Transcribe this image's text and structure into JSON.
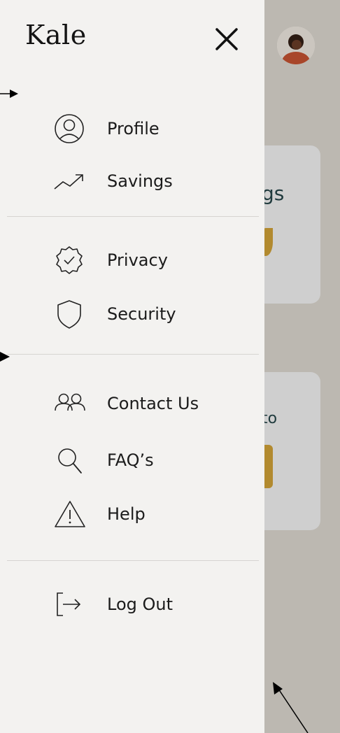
{
  "drawer": {
    "brand": "Kale",
    "sections": [
      [
        {
          "label": "Profile",
          "icon": "user-circle-icon"
        },
        {
          "label": "Savings",
          "icon": "trending-up-icon"
        }
      ],
      [
        {
          "label": "Privacy",
          "icon": "badge-check-icon"
        },
        {
          "label": "Security",
          "icon": "shield-icon"
        }
      ],
      [
        {
          "label": "Contact Us",
          "icon": "users-icon"
        },
        {
          "label": "FAQ’s",
          "icon": "search-icon"
        },
        {
          "label": "Help",
          "icon": "warning-icon"
        }
      ],
      [
        {
          "label": "Log Out",
          "icon": "logout-icon"
        }
      ]
    ]
  },
  "background": {
    "card1_text": "gs",
    "card2_text": "to"
  },
  "colors": {
    "drawer_bg": "#f3f2f0",
    "backdrop": "#bcb8b1",
    "accent_gold": "#b28a2f",
    "text": "#1b1b1b"
  }
}
